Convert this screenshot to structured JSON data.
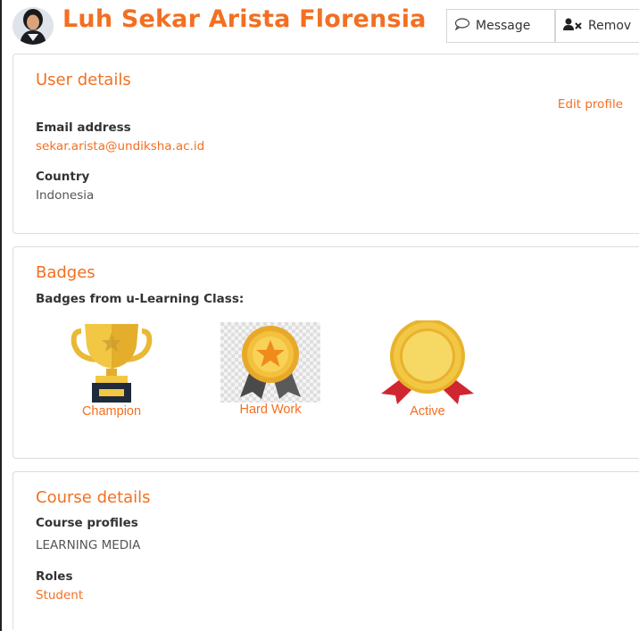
{
  "header": {
    "user_name": "Luh Sekar Arista Florensia",
    "message_label": "Message",
    "remove_label": "Remov"
  },
  "user_details": {
    "title": "User details",
    "edit_profile": "Edit profile",
    "email_label": "Email address",
    "email_value": "sekar.arista@undiksha.ac.id",
    "country_label": "Country",
    "country_value": "Indonesia"
  },
  "badges": {
    "title": "Badges",
    "subtitle": "Badges from u-Learning Class:",
    "items": [
      {
        "label": "Champion",
        "icon": "trophy-icon"
      },
      {
        "label": "Hard Work",
        "icon": "star-medal-icon"
      },
      {
        "label": "Active",
        "icon": "rosette-icon"
      }
    ]
  },
  "course_details": {
    "title": "Course details",
    "profiles_label": "Course profiles",
    "profiles_value": "LEARNING MEDIA",
    "roles_label": "Roles",
    "roles_value": "Student"
  },
  "colors": {
    "accent": "#f36f21",
    "gold": "#f2c744",
    "ribbon_red": "#d0262f"
  }
}
